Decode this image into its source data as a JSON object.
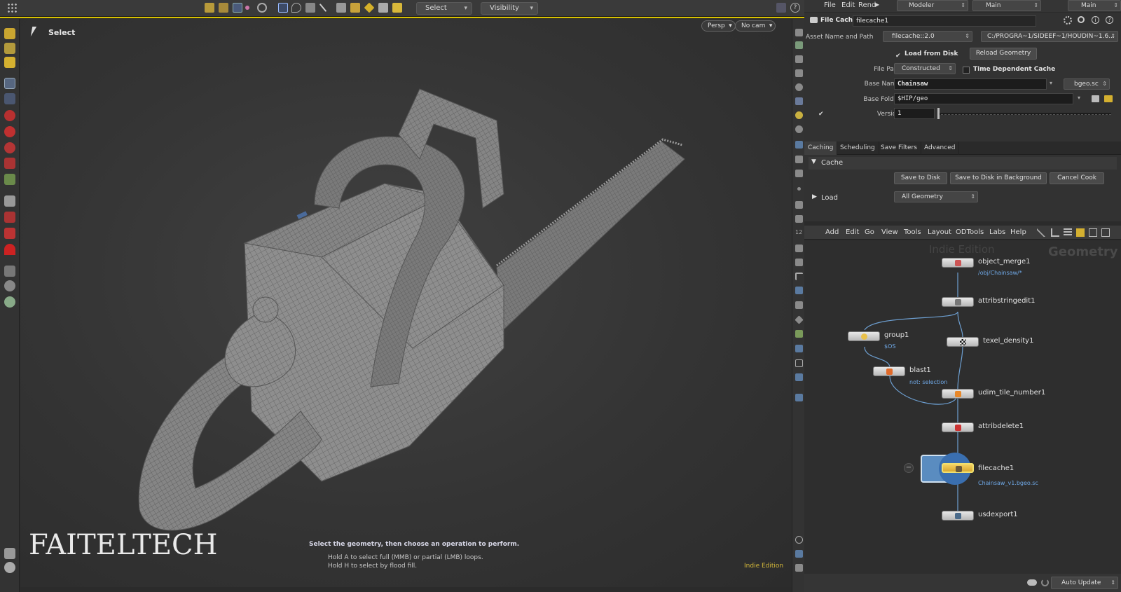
{
  "topbar": {
    "select_mode": "Select",
    "visibility": "Visibility"
  },
  "viewport": {
    "tool_title": "Select",
    "camera_view": "Persp",
    "camera": "No cam",
    "hint_main": "Select the geometry, then choose an operation to perform.",
    "hint_line1": "Hold A to select full (MMB) or partial (LMB) loops.",
    "hint_line2": "Hold H to select by flood fill.",
    "edition": "Indie Edition",
    "logo_text": "FAITELTECH"
  },
  "menubar": {
    "file": "File",
    "edit": "Edit",
    "render": "Rend",
    "desktop": "Modeler",
    "main1": "Main",
    "main2": "Main"
  },
  "params": {
    "node_type": "File Cache",
    "node_name": "filecache1",
    "asset_label": "Asset Name and Path",
    "asset_name": "filecache::2.0",
    "asset_path": "C:/PROGRA~1/SIDEEF~1/HOUDIN~1.6...",
    "load_from_disk": "Load from Disk",
    "reload_geometry": "Reload Geometry",
    "file_path_label": "File Path",
    "file_path_mode": "Constructed",
    "time_dependent": "Time Dependent Cache",
    "base_name_label": "Base Name",
    "base_name": "Chainsaw",
    "extension": "bgeo.sc",
    "base_folder_label": "Base Folder",
    "base_folder": "$HIP/geo",
    "version_label": "Version",
    "version": "1",
    "tabs": [
      "Caching",
      "Scheduling",
      "Save Filters",
      "Advanced"
    ],
    "cache_section": "Cache",
    "save_to_disk": "Save to Disk",
    "save_background": "Save to Disk in Background",
    "cancel_cook": "Cancel Cook",
    "load_label": "Load",
    "load_mode": "All Geometry"
  },
  "network": {
    "menu": [
      "Add",
      "Edit",
      "Go",
      "View",
      "Tools",
      "Layout",
      "ODTools",
      "Labs",
      "Help"
    ],
    "watermark": "Indie Edition",
    "context": "Geometry",
    "nodes": {
      "object_merge": "object_merge1",
      "object_merge_sub": "/obj/Chainsaw/*",
      "attribstringedit": "attribstringedit1",
      "group": "group1",
      "group_sub": "$OS",
      "texel_density": "texel_density1",
      "blast": "blast1",
      "blast_sub": "not: selection",
      "udim": "udim_tile_number1",
      "attribdelete": "attribdelete1",
      "filecache": "filecache1",
      "filecache_sub": "Chainsaw_v1.bgeo.sc",
      "usdexport": "usdexport1"
    },
    "auto_update": "Auto Update"
  }
}
